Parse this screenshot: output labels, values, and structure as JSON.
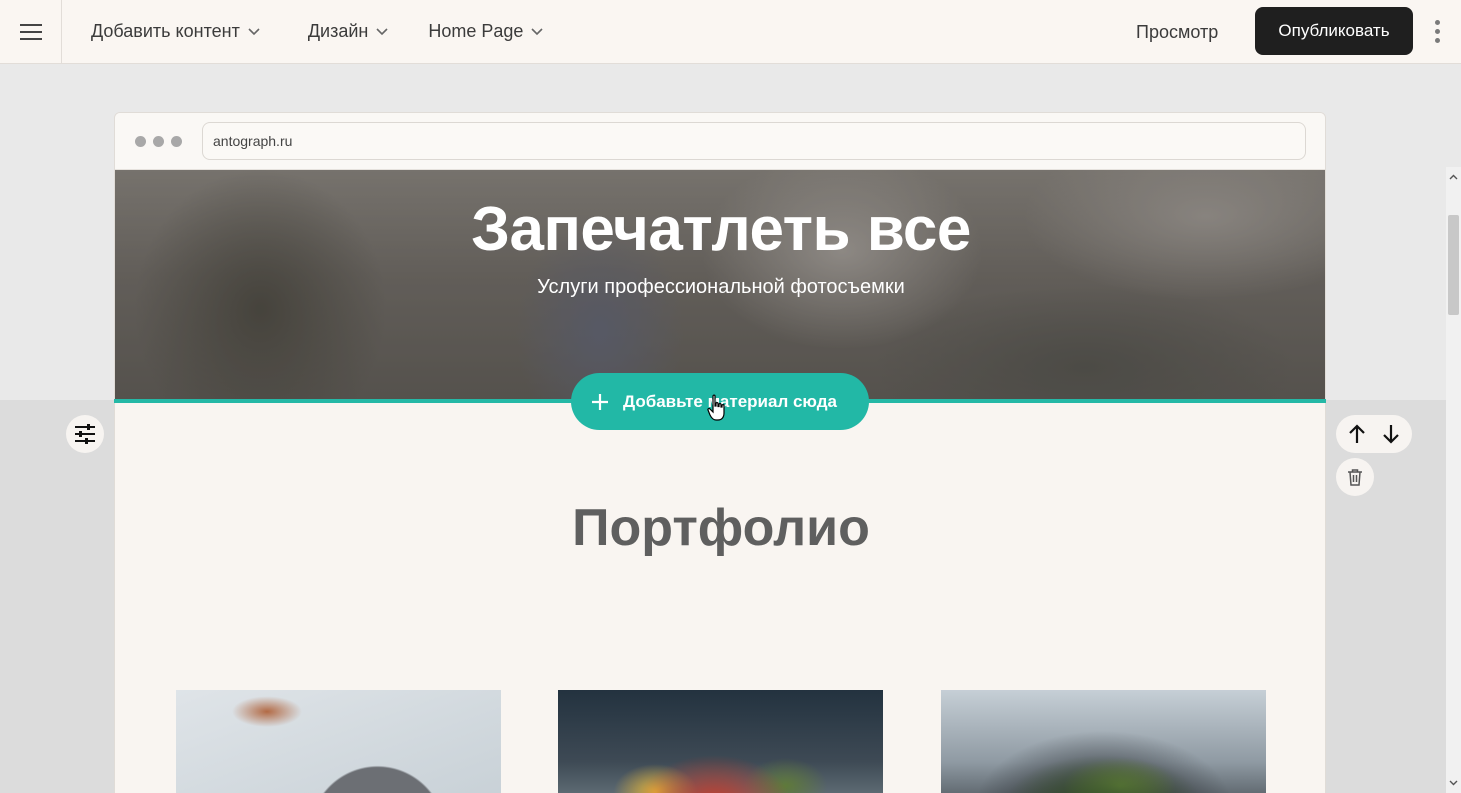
{
  "topbar": {
    "menu_items": [
      {
        "label": "Добавить контент"
      },
      {
        "label": "Дизайн"
      },
      {
        "label": "Home Page"
      }
    ],
    "preview_label": "Просмотр",
    "publish_label": "Опубликовать"
  },
  "browser": {
    "url": "antograph.ru"
  },
  "hero": {
    "title": "Запечатлеть все",
    "subtitle": "Услуги профессиональной фотосъемки"
  },
  "add_content": {
    "label": "Добавьте материал сюда"
  },
  "portfolio": {
    "title": "Портфолио"
  },
  "colors": {
    "accent": "#22b8a6",
    "publish_bg": "#1f1f1f",
    "topbar_bg": "#faf6f2"
  },
  "icons": [
    "hamburger-icon",
    "chevron-down-icon",
    "kebab-icon",
    "plus-icon",
    "sliders-icon",
    "arrow-up-icon",
    "arrow-down-icon",
    "trash-icon",
    "hand-cursor-icon"
  ]
}
